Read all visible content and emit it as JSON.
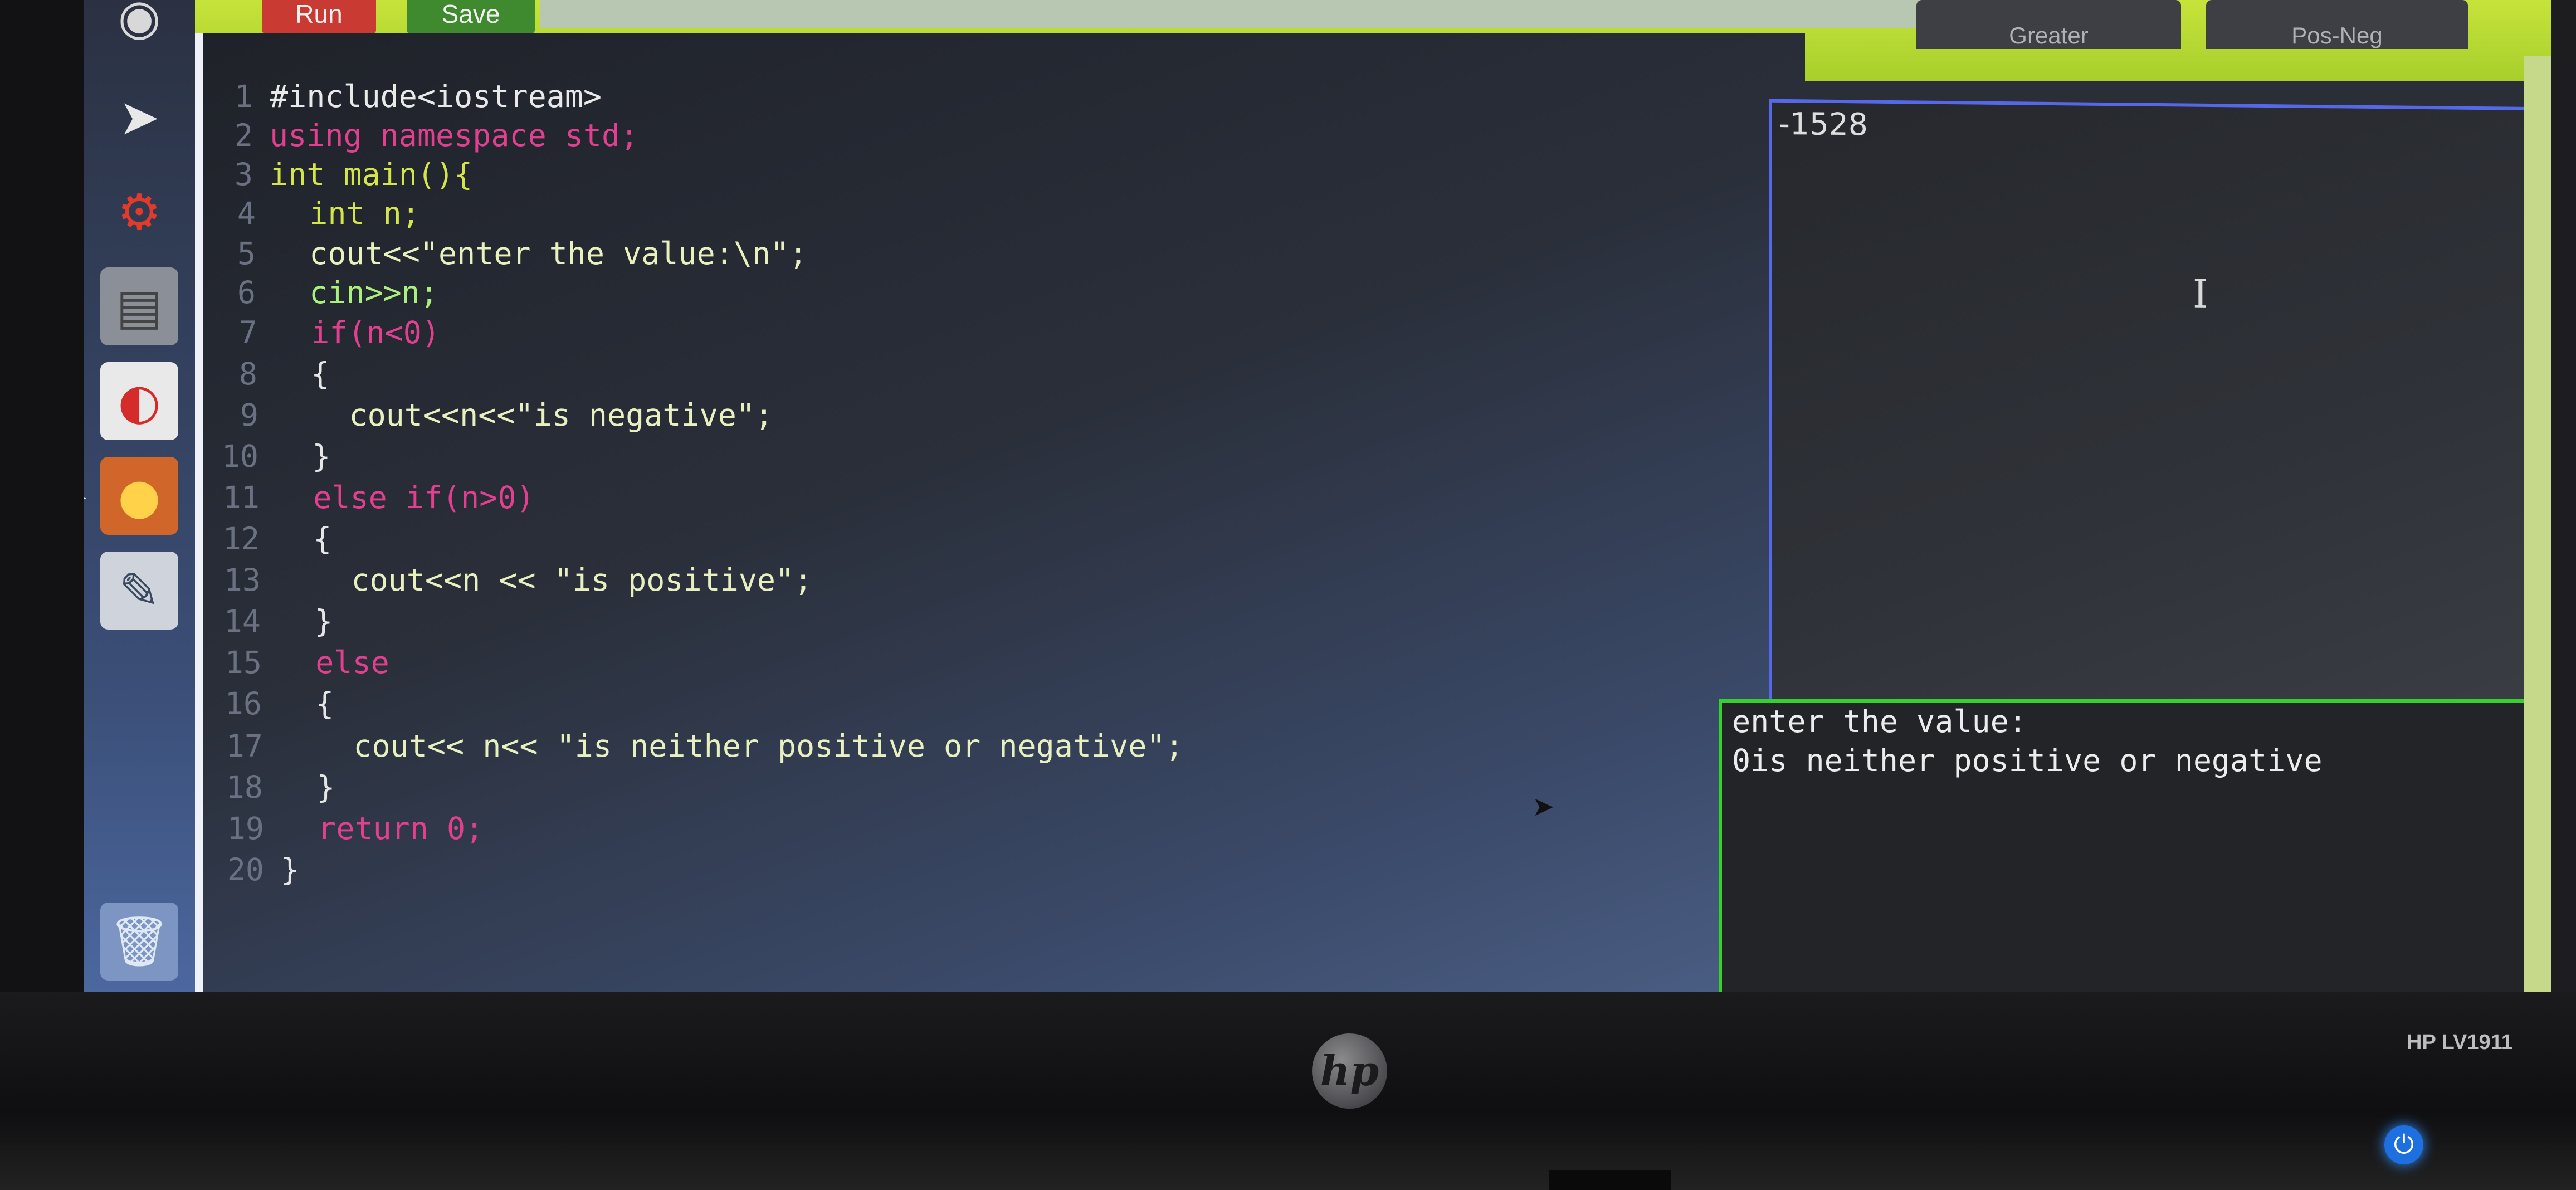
{
  "toolbar": {
    "run_label": "Run",
    "save_label": "Save",
    "tabs": [
      "Greater",
      "Pos-Neg"
    ]
  },
  "editor": {
    "lines": [
      {
        "num": "1",
        "code": "#include<iostream>"
      },
      {
        "num": "2",
        "code": "using namespace std;"
      },
      {
        "num": "3",
        "code": "int main(){"
      },
      {
        "num": "4",
        "code": "  int n;"
      },
      {
        "num": "5",
        "code": "  cout<<\"enter the value:\\n\";"
      },
      {
        "num": "6",
        "code": "  cin>>n;"
      },
      {
        "num": "7",
        "code": "  if(n<0)"
      },
      {
        "num": "8",
        "code": "  {"
      },
      {
        "num": "9",
        "code": "    cout<<n<<\"is negative\";"
      },
      {
        "num": "10",
        "code": "  }"
      },
      {
        "num": "11",
        "code": "  else if(n>0)"
      },
      {
        "num": "12",
        "code": "  {"
      },
      {
        "num": "13",
        "code": "    cout<<n << \"is positive\";"
      },
      {
        "num": "14",
        "code": "  }"
      },
      {
        "num": "15",
        "code": "  else"
      },
      {
        "num": "16",
        "code": "  {"
      },
      {
        "num": "17",
        "code": "    cout<< n<< \"is neither positive or negative\";"
      },
      {
        "num": "18",
        "code": "  }"
      },
      {
        "num": "19",
        "code": "  return 0;"
      },
      {
        "num": "20",
        "code": "}"
      }
    ]
  },
  "input_pane": {
    "value": "-1528"
  },
  "output_pane": {
    "lines": [
      "enter the value:",
      "0is neither positive or negative"
    ]
  },
  "monitor": {
    "brand": "hp",
    "model": "HP LV1911"
  },
  "colors": {
    "toolbar": "#b7d832",
    "run": "#c93a33",
    "save": "#3f8a2f",
    "input_border": "#5568e8",
    "output_border": "#37d12e"
  }
}
